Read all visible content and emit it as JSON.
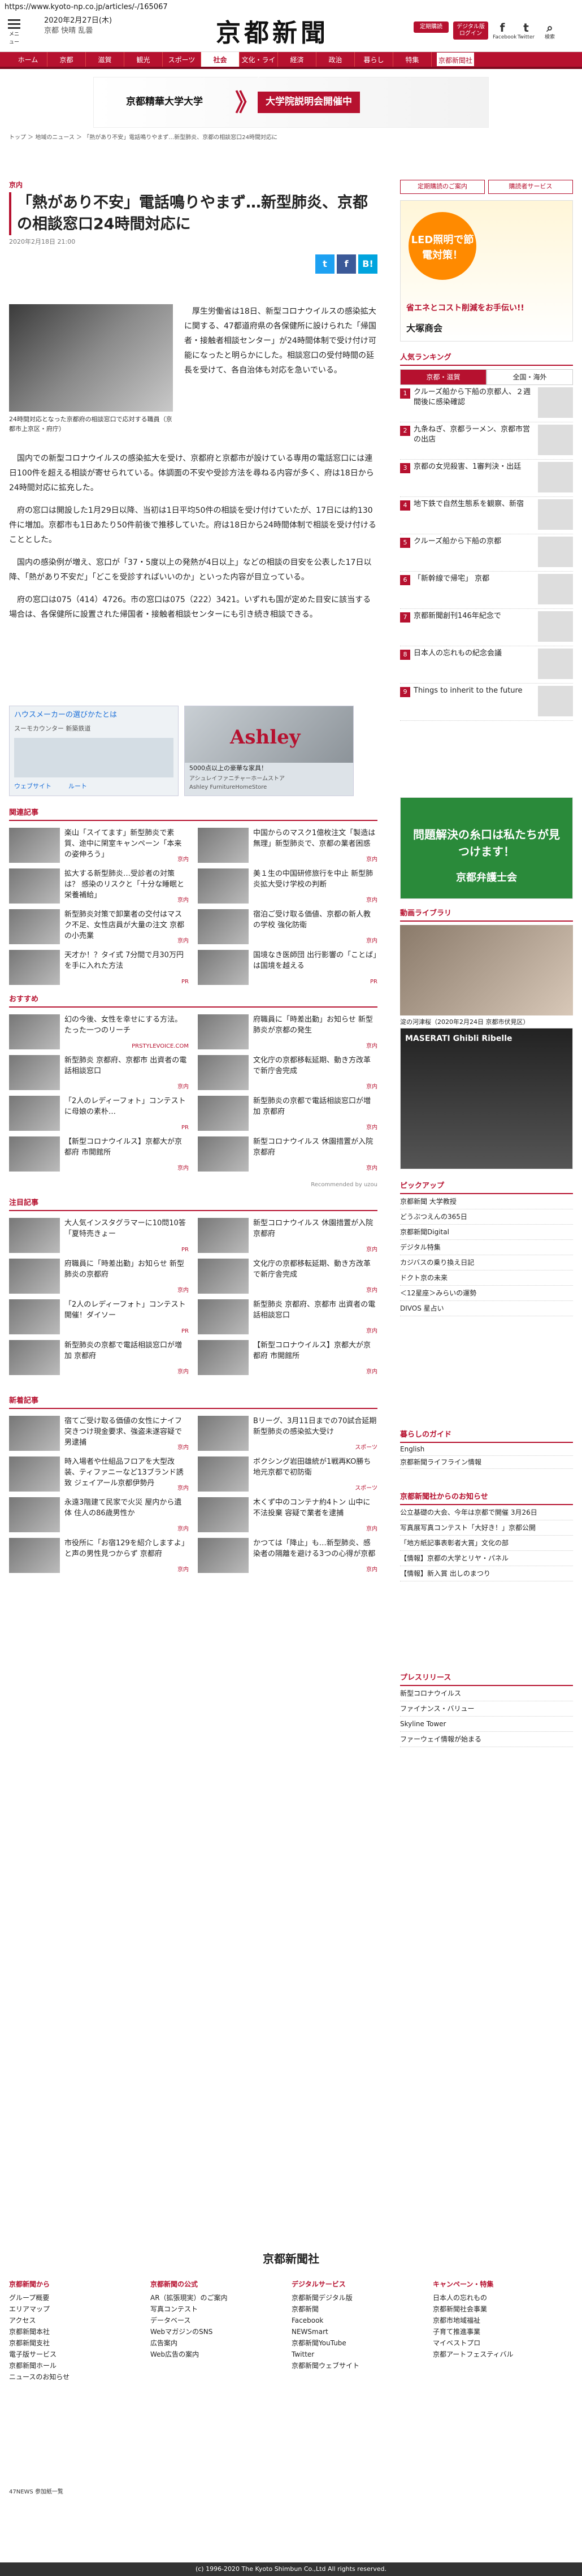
{
  "url": "https://www.kyoto-np.co.jp/articles/-/165067",
  "header": {
    "menu_label": "メニュー",
    "date": "2020年2月27日(木)",
    "weather": [
      "京都",
      "快晴",
      "乱曇"
    ],
    "logo": "京都新聞",
    "btn_subscribe": "定期購読",
    "btn_digital": "デジタル版ログイン",
    "social": [
      {
        "name": "Facebook",
        "glyph": "f"
      },
      {
        "name": "Twitter",
        "glyph": "t"
      },
      {
        "name": "検索",
        "glyph": "⌕"
      }
    ]
  },
  "nav": [
    "ホーム",
    "京都",
    "滋賀",
    "観光",
    "スポーツ",
    "社会",
    "文化・ライフ",
    "経済",
    "政治",
    "暮らし",
    "特集",
    "京都新聞社"
  ],
  "nav_active": 5,
  "banner": {
    "left": "京都精華大学大学",
    "right": "大学院説明会開催中"
  },
  "breadcrumb": "トップ ＞ 地域のニュース ＞ 「熱があり不安」電話鳴りやまず…新型肺炎、京都の相談窓口24時間対応に",
  "article": {
    "category": "京内",
    "title": "「熱があり不安」電話鳴りやまず…新型肺炎、京都の相談窓口24時間対応に",
    "date": "2020年2月18日 21:00",
    "share": [
      "t",
      "f",
      "B!"
    ],
    "photo_caption": "24時間対応となった京都府の相談窓口で応対する職員（京都市上京区・府庁）",
    "lead": "厚生労働省は18日、新型コロナウイルスの感染拡大に関する、47都道府県の各保健所に設けられた「帰国者・接触者相談センター」が24時間体制で受け付け可能になったと明らかにした。相談窓口の受付時間の延長を受けて、各自治体も対応を急いでいる。",
    "paragraphs": [
      "国内での新型コロナウイルスの感染拡大を受け、京都府と京都市が設けている専用の電話窓口には連日100件を超える相談が寄せられている。体調面の不安や受診方法を尋ねる内容が多く、府は18日から24時間対応に拡充した。",
      "府の窓口は開設した1月29日以降、当初は1日平均50件の相談を受け付けていたが、17日には約130件に増加。京都市も1日あたり50件前後で推移していた。府は18日から24時間体制で相談を受け付けることとした。",
      "国内の感染例が増え、窓口が「37・5度以上の発熱が4日以上」などの相談の目安を公表した17日以降、「熱があり不安だ」「どこを受診すればいいのか」といった内容が目立っている。",
      "府の窓口は075（414）4726。市の窓口は075（222）3421。いずれも国が定めた目安に該当する場合は、各保健所に設置された帰国者・接触者相談センターにも引き続き相談できる。"
    ]
  },
  "ads": {
    "map_title": "ハウスメーカーの選びかたとは",
    "map_sub": "スーモカウンター 新築鉄道",
    "map_btn1": "ウェブサイト",
    "map_btn2": "ルート",
    "ashley_brand": "Ashley",
    "ashley_line1": "5000点以上の豪華な家具！",
    "ashley_line2": "アシュレイファニチャーホームストア",
    "ashley_line3": "Ashley FurnitureHomeStore"
  },
  "related": {
    "heading": "関連記事",
    "items": [
      {
        "text": "楽山「スイてます」新型肺炎で素質、途中に閑室キャンペーン「本来の姿伸ろう」",
        "src": "京内"
      },
      {
        "text": "中国からのマスク1億枚注文「製造は無理」新型肺炎で、京都の業者困惑",
        "src": "京内"
      },
      {
        "text": "拡大する新型肺炎…受診者の対策は？ 感染のリスクと「十分な睡眠と栄養補給」",
        "src": "京内"
      },
      {
        "text": "美１生の中国研修旅行を中止 新型肺炎拡大受け学校の判断",
        "src": "京内"
      },
      {
        "text": "新型肺炎対策で卸業者の交付はマスク不足、女性店員が大量の注文 京都の小売業",
        "src": "京内"
      },
      {
        "text": "宿泊ご受け取る価値、京都の新人教の学校 強化防衛",
        "src": "京内"
      },
      {
        "text": "天才か！？タイ式 7分間で月30万円を手に入れた方法",
        "src": "PR"
      },
      {
        "text": "国境なき医師団 出行影響の「ことば」は国境を越える",
        "src": "PR"
      }
    ]
  },
  "recommend": {
    "heading": "おすすめ",
    "items": [
      {
        "text": "幻の今後、女性を幸せにする方法。たった一つのリーチ",
        "src": "PRSTYLEVOICE.COM"
      },
      {
        "text": "府職員に「時差出勤」お知らせ 新型肺炎が京都の発生",
        "src": "京内"
      },
      {
        "text": "新型肺炎 京都府、京都市 出資者の電話相談窓口",
        "src": "京内"
      },
      {
        "text": "文化庁の京都移転延期、動き方改革で新庁舎完成",
        "src": "京内"
      },
      {
        "text": "「2人のレディーフォト」コンテストに母娘の素朴…",
        "src": "PR"
      },
      {
        "text": "新型肺炎の京都で電話相談窓口が増加 京都府",
        "src": "京内"
      },
      {
        "text": "【新型コロナウイルス】京都大が京都府 市開館所",
        "src": "京内"
      },
      {
        "text": "新型コロナウイルス 休園措置が入院 京都府",
        "src": "京内"
      }
    ],
    "footer": "Recommended by uzou"
  },
  "attention": {
    "heading": "注目記事",
    "items": [
      {
        "text": "大人気インスタグラマーに10問10答「夏特売きょー",
        "src": "PR"
      },
      {
        "text": "新型コロナウイルス 休園措置が入院 京都府",
        "src": "京内"
      },
      {
        "text": "府職員に「時差出勤」お知らせ 新型肺炎の京都府",
        "src": "京内"
      },
      {
        "text": "文化庁の京都移転延期、動き方改革で新庁舎完成",
        "src": "京内"
      },
      {
        "text": "「2人のレディーフォト」コンテスト開催！ダイソー",
        "src": "PR"
      },
      {
        "text": "新型肺炎 京都府、京都市 出資者の電話相談窓口",
        "src": "京内"
      },
      {
        "text": "新型肺炎の京都で電話相談窓口が増加 京都府",
        "src": "京内"
      },
      {
        "text": "【新型コロナウイルス】京都大が京都府 市開館所",
        "src": "京内"
      }
    ]
  },
  "latest": {
    "heading": "新着記事",
    "items": [
      {
        "text": "宿てご受け取る価値の女性にナイフ突きつけ現金要求、強盗未遂容疑で男逮捕",
        "src": "京内"
      },
      {
        "text": "Bリーグ、3月11日までの70試合延期 新型肺炎の感染拡大受け",
        "src": "スポーツ"
      },
      {
        "text": "時入場者や仕組品フロアを大型改装、ティファニーなど13ブランド誘致 ジェイアール京都伊勢丹",
        "src": "京内"
      },
      {
        "text": "ボクシング岩田雄統が1戦再KO勝ち 地元京都で初防衛",
        "src": "スポーツ"
      },
      {
        "text": "永遠3階建て民家で火災 屋内から遺体 住人の86歳男性か",
        "src": "京内"
      },
      {
        "text": "木くず中のコンテナ約4トン 山中に不法投棄 容疑で業者を逮捕",
        "src": "京内"
      },
      {
        "text": "市役所に「お宿129を紹介しますよ」と声の男性見つからず 京都府",
        "src": "京内"
      },
      {
        "text": "かつては「降止」も…新型肺炎、感染者の隔離を避ける3つの心得が京都",
        "src": "京内"
      }
    ]
  },
  "sidebar": {
    "links": [
      "定期購読のご案内",
      "購読者サービス"
    ],
    "ad_top1": "LED照明で節電対策！",
    "ad_top2": "省エネとコスト削減をお手伝い!!",
    "ad_top3": "大塚商会",
    "ranking_heading": "人気ランキング",
    "ranking_tabs": [
      "京都・滋賀",
      "全国・海外"
    ],
    "ranking": [
      "クルーズ船から下船の京都人、２週間後に感染確認",
      "九条ねぎ、京都ラーメン、京都市営の出店",
      "京都の女児殺害、1審判決・出廷",
      "地下鉄で自然生態系を観察、新宿",
      "クルーズ船から下船の京都",
      "「新幹線で帰宅」 京都",
      "京都新聞創刊146年紀念で",
      "日本人の忘れもの紀念会議",
      "Things to inherit to the future"
    ],
    "ad_mid1": "問題解決の糸口は私たちが見つけます！",
    "ad_mid2": "京都弁護士会",
    "video_heading": "動画ライブラリ",
    "video_caption": "淀の河津桜（2020年2月24日 京都市伏見区）",
    "car_ad": "MASERATI Ghibli Ribelle",
    "pickup_heading": "ピックアップ",
    "pickup": [
      "京都新聞 大学教授",
      "どうぶつえんの365日",
      "京都新聞Digital",
      "デジタル特集",
      "カジバスの乗り換え日記",
      "ドクト京の未来",
      "＜12星座＞みらいの運勢",
      "DIVOS 星占い"
    ],
    "life_heading": "暮らしのガイド",
    "life": [
      "English",
      "京都新聞ライフライン情報"
    ],
    "notice_heading": "京都新聞社からのお知らせ",
    "notices": [
      "公立基礎の大会、今年は京都で開催 3月26日",
      "写真展写真コンテスト「大好き！」京都公開",
      "「地方紙記事表彰者大賞」文化の部",
      "【情報】京都の大学とリヤ・パネル",
      "【情報】新入賞 出しのまつり"
    ],
    "press_heading": "プレスリリース",
    "press": [
      "新型コロナウイルス",
      "ファイナンス・バリュー",
      "Skyline Tower",
      "ファーウェイ情報が始まる"
    ]
  },
  "footer": {
    "logo": "京都新聞社",
    "cols": [
      {
        "h": "京都新聞から",
        "items": [
          "グループ概要",
          "エリアマップ",
          "アクセス",
          "京都新聞本社",
          "京都新聞支社",
          "電子版サービス",
          "京都新聞ホール",
          "ニュースのお知らせ"
        ]
      },
      {
        "h": "京都新聞の公式",
        "items": [
          "AR（拡張現実）のご案内",
          "写真コンテスト",
          "データベース",
          "WebマガジンのSNS",
          "広告案内",
          "Web広告の案内"
        ]
      },
      {
        "h": "デジタルサービス",
        "items": [
          "京都新聞デジタル版",
          "京都新聞",
          "Facebook",
          "NEWSmart",
          "京都新聞YouTube",
          "Twitter",
          "京都新聞ウェブサイト"
        ]
      },
      {
        "h": "キャンペーン・特集",
        "items": [
          "日本人の忘れもの",
          "京都新聞社会事業",
          "京都市地域福祉",
          "子育て推進事業",
          "マイベストプロ",
          "京都アートフェスティバル"
        ]
      }
    ],
    "news47": "47NEWS 参加紙一覧",
    "copyright": "(c) 1996-2020 The Kyoto Shimbun Co.,Ltd All rights reserved."
  }
}
